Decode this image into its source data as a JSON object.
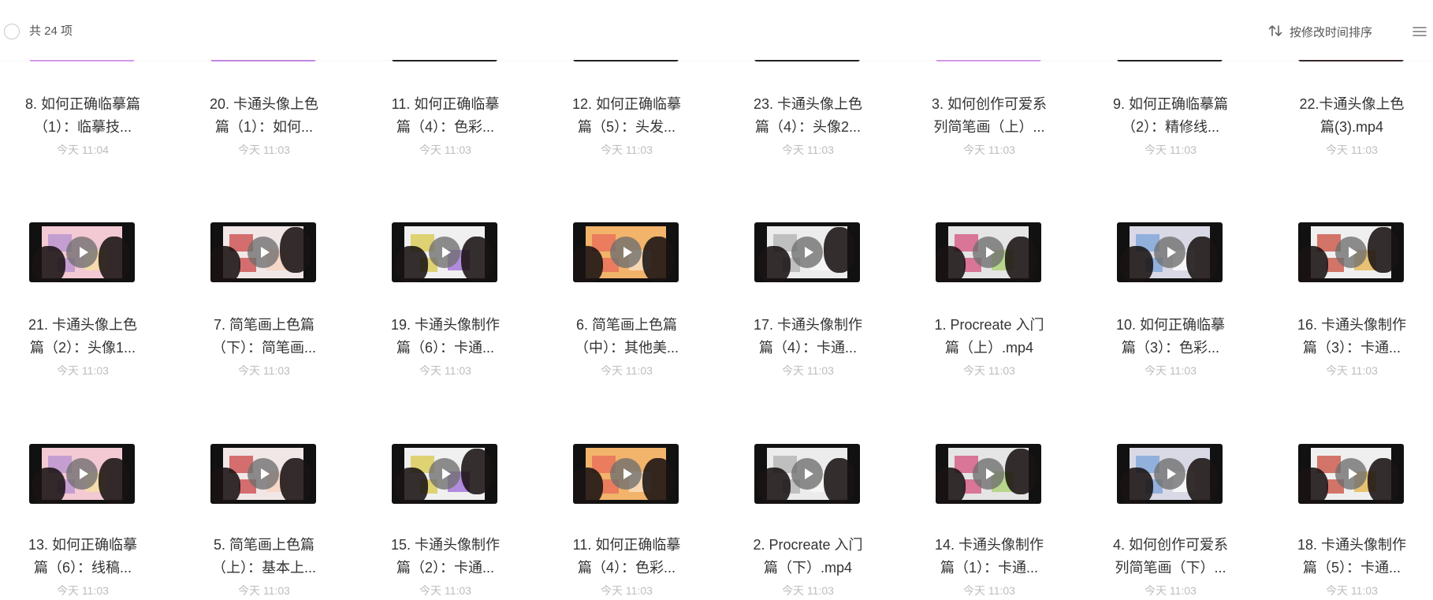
{
  "header": {
    "count_label": "共 24 项",
    "sort_label": "按修改时间排序",
    "sort_icon": "sort-arrows-icon",
    "menu_icon": "list-view-icon"
  },
  "files": [
    {
      "line1": "8. 如何正确临摹篇",
      "line2": "（1）：临摹技...",
      "time": "今天 11:04",
      "stripe": "#d69ee8"
    },
    {
      "line1": "20. 卡通头像上色",
      "line2": "篇（1）：如何...",
      "time": "今天 11:03",
      "stripe": "#c48ae6"
    },
    {
      "line1": "11. 如何正确临摹",
      "line2": "篇（4）：色彩...",
      "time": "今天 11:03",
      "stripe": "#222222"
    },
    {
      "line1": "12. 如何正确临摹",
      "line2": "篇（5）：头发...",
      "time": "今天 11:03",
      "stripe": "#222222"
    },
    {
      "line1": "23. 卡通头像上色",
      "line2": "篇（4）：头像2...",
      "time": "今天 11:03",
      "stripe": "#222222"
    },
    {
      "line1": "3. 如何创作可爱系",
      "line2": "列简笔画（上）...",
      "time": "今天 11:03",
      "stripe": "#d69ee8"
    },
    {
      "line1": "9. 如何正确临摹篇",
      "line2": "（2）：精修线...",
      "time": "今天 11:03",
      "stripe": "#222222"
    },
    {
      "line1": "22.卡通头像上色",
      "line2": "篇(3).mp4",
      "time": "今天 11:03",
      "stripe": "#3a2a2a"
    },
    {
      "line1": "21. 卡通头像上色",
      "line2": "篇（2）：头像1...",
      "time": "今天 11:03"
    },
    {
      "line1": "7. 简笔画上色篇",
      "line2": "（下）：简笔画...",
      "time": "今天 11:03"
    },
    {
      "line1": "19. 卡通头像制作",
      "line2": "篇（6）：卡通...",
      "time": "今天 11:03"
    },
    {
      "line1": "6. 简笔画上色篇",
      "line2": "（中）：其他美...",
      "time": "今天 11:03"
    },
    {
      "line1": "17. 卡通头像制作",
      "line2": "篇（4）：卡通...",
      "time": "今天 11:03"
    },
    {
      "line1": "1. Procreate 入门",
      "line2": "篇（上）.mp4",
      "time": "今天 11:03"
    },
    {
      "line1": "10. 如何正确临摹",
      "line2": "篇（3）：色彩...",
      "time": "今天 11:03"
    },
    {
      "line1": "16. 卡通头像制作",
      "line2": "篇（3）：卡通...",
      "time": "今天 11:03"
    },
    {
      "line1": "13. 如何正确临摹",
      "line2": "篇（6）：线稿...",
      "time": "今天 11:03"
    },
    {
      "line1": "5. 简笔画上色篇",
      "line2": "（上）：基本上...",
      "time": "今天 11:03"
    },
    {
      "line1": "15. 卡通头像制作",
      "line2": "篇（2）：卡通...",
      "time": "今天 11:03"
    },
    {
      "line1": "11. 如何正确临摹",
      "line2": "篇（4）：色彩...",
      "time": "今天 11:03"
    },
    {
      "line1": "2. Procreate 入门",
      "line2": "篇（下）.mp4",
      "time": "今天 11:03"
    },
    {
      "line1": "14. 卡通头像制作",
      "line2": "篇（1）：卡通...",
      "time": "今天 11:03"
    },
    {
      "line1": "4. 如何创作可爱系",
      "line2": "列简笔画（下）...",
      "time": "今天 11:03"
    },
    {
      "line1": "18. 卡通头像制作",
      "line2": "篇（5）：卡通...",
      "time": "今天 11:03"
    }
  ]
}
